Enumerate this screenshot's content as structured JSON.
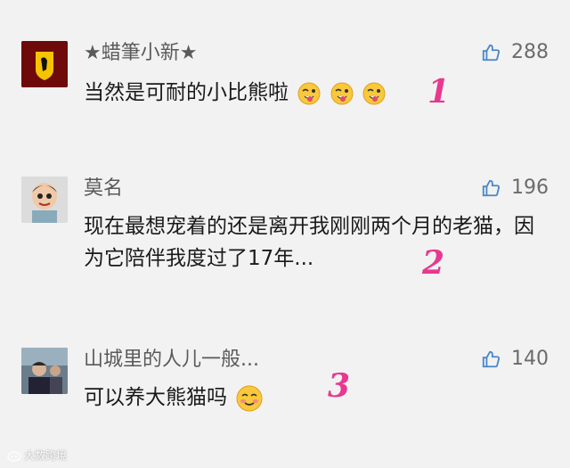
{
  "comments": [
    {
      "name": "★蜡筆小新★",
      "likes": "288",
      "text": "当然是可耐的小比熊啦",
      "annotation": "1"
    },
    {
      "name": "莫名",
      "likes": "196",
      "text": "现在最想宠着的还是离开我刚刚两个月的老猫，因为它陪伴我度过了17年...",
      "annotation": "2"
    },
    {
      "name": "山城里的人儿一般...",
      "likes": "140",
      "text": "可以养大熊猫吗",
      "annotation": "3"
    }
  ],
  "watermark": "大数跨境",
  "colors": {
    "background": "#f2f2f2",
    "annotation": "#e8388f"
  }
}
